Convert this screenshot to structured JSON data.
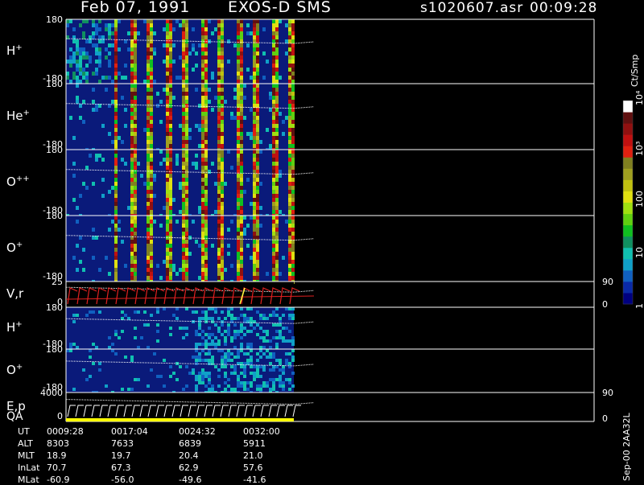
{
  "header": {
    "date": "Feb 07, 1991",
    "instrument": "EXOS-D SMS",
    "file": "s1020607.asr",
    "time": "00:09:28"
  },
  "panels": [
    {
      "label": "H",
      "sup": "+",
      "top_tick": "180",
      "bottom_tick": "-180"
    },
    {
      "label": "He",
      "sup": "+",
      "top_tick": "180",
      "bottom_tick": "-180"
    },
    {
      "label": "O",
      "sup": "++",
      "top_tick": "180",
      "bottom_tick": "-180"
    },
    {
      "label": "O",
      "sup": "+",
      "top_tick": "180",
      "bottom_tick": "-180"
    },
    {
      "label": "V,r",
      "sup": "",
      "top_tick": "25",
      "bottom_tick": "0",
      "right_top": "90",
      "right_bottom": "0"
    },
    {
      "label": "H",
      "sup": "+",
      "top_tick": "180",
      "bottom_tick": "-180"
    },
    {
      "label": "O",
      "sup": "+",
      "top_tick": "180",
      "bottom_tick": "-180"
    },
    {
      "label": "E,p",
      "sup": "",
      "top_tick": "4000",
      "bottom_tick": "0",
      "right_top": "90",
      "right_bottom": "0"
    }
  ],
  "qa_label": "QA",
  "colorbar": {
    "title": "Ct/Smp",
    "tick_labels": [
      "1",
      "10",
      "100",
      "10³",
      "10⁴"
    ],
    "range": [
      1,
      10000
    ],
    "scale": "log",
    "colors": [
      "#000080",
      "#0a2aa8",
      "#1060c0",
      "#10a0c8",
      "#10c0b0",
      "#109060",
      "#10c020",
      "#60d010",
      "#a0e010",
      "#e0e010",
      "#c0c010",
      "#a0a020",
      "#808020",
      "#e02010",
      "#c01010",
      "#901010",
      "#601010",
      "#ffffff"
    ]
  },
  "ephemeris": {
    "row_labels": [
      "UT",
      "ALT",
      "MLT",
      "InLat",
      "MLat"
    ],
    "columns": [
      {
        "UT": "0009:28",
        "ALT": "8303",
        "MLT": "18.9",
        "InLat": "70.7",
        "MLat": "-60.9"
      },
      {
        "UT": "0017:04",
        "ALT": "7633",
        "MLT": "19.7",
        "InLat": "67.3",
        "MLat": "-56.0"
      },
      {
        "UT": "0024:32",
        "ALT": "6839",
        "MLT": "20.4",
        "InLat": "62.9",
        "MLat": "-49.6"
      },
      {
        "UT": "0032:00",
        "ALT": "5911",
        "MLT": "21.0",
        "InLat": "57.6",
        "MLat": "-41.6"
      }
    ]
  },
  "footer_note": "Sep-00  2AA32L",
  "chart_data": {
    "type": "heatmap",
    "title": "Feb 07, 1991   EXOS-D SMS",
    "x": [
      "0009:28",
      "0017:04",
      "0024:32",
      "0032:00"
    ],
    "ylabel_panels": [
      "H+",
      "He+",
      "O++",
      "O+",
      "V,r",
      "H+",
      "O+",
      "E,p"
    ],
    "ylim_angle": [
      -180,
      180
    ],
    "colorbar_range": [
      1,
      10000
    ],
    "colorbar_unit": "Ct/Smp"
  }
}
